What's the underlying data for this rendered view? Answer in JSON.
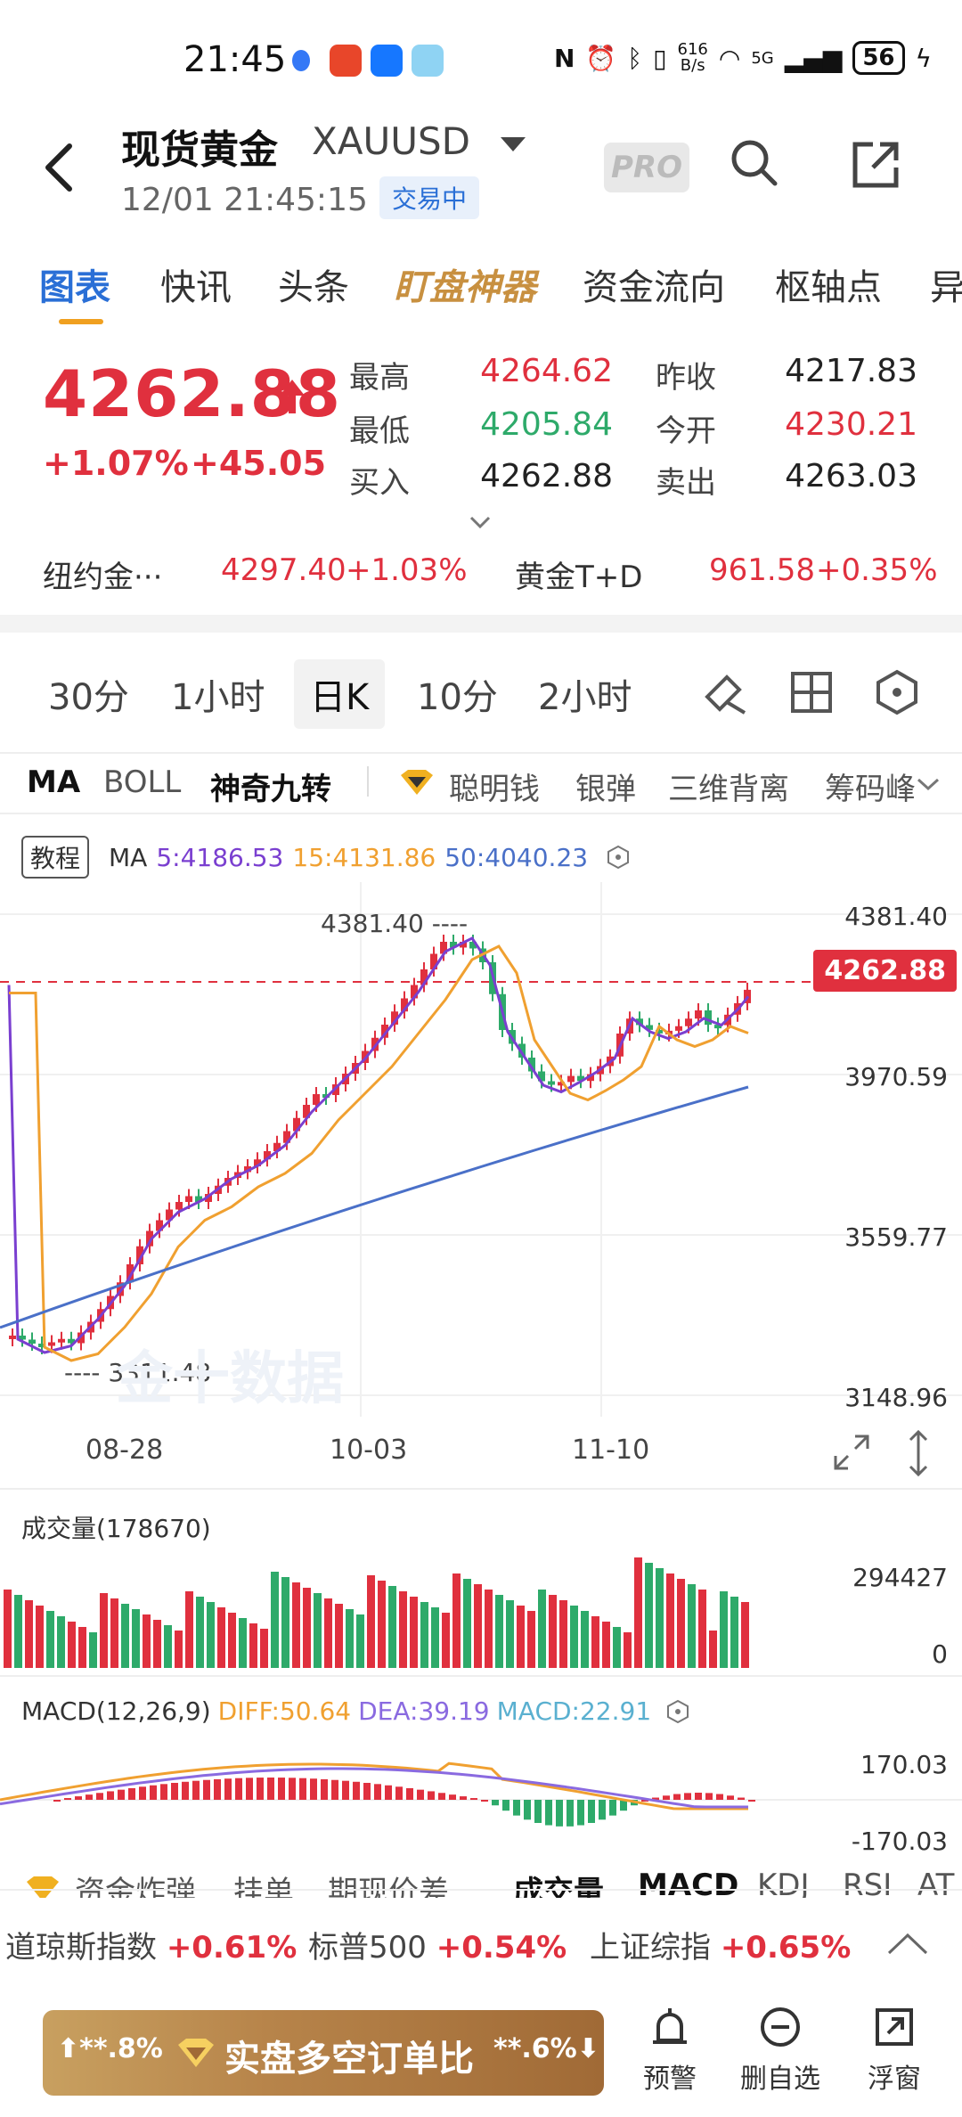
{
  "status_bar": {
    "time": "21:45",
    "net_speed_top": "616",
    "net_speed_bottom": "B/s",
    "signal": "5G",
    "battery": "56"
  },
  "header": {
    "title": "现货黄金",
    "symbol": "XAUUSD",
    "datetime": "12/01 21:45:15",
    "status_badge": "交易中",
    "pro_label": "PRO"
  },
  "tabs": [
    "图表",
    "快讯",
    "头条",
    "盯盘神器",
    "资金流向",
    "枢轴点",
    "异"
  ],
  "quote": {
    "last": "4262.88",
    "chg_pct": "+1.07%",
    "chg": "+45.05",
    "high_label": "最高",
    "high": "4264.62",
    "low_label": "最低",
    "low": "4205.84",
    "bid_label": "买入",
    "bid": "4262.88",
    "prev_label": "昨收",
    "prev": "4217.83",
    "open_label": "今开",
    "open": "4230.21",
    "ask_label": "卖出",
    "ask": "4263.03"
  },
  "related": [
    {
      "name": "纽约金···",
      "price": "4297.40",
      "chg": "+1.03%"
    },
    {
      "name": "黄金T+D",
      "price": "961.58",
      "chg": "+0.35%"
    }
  ],
  "periods": [
    "30分",
    "1小时",
    "日K",
    "10分",
    "2小时"
  ],
  "indicators": [
    "MA",
    "BOLL",
    "神奇九转",
    "聪明钱",
    "银弹",
    "三维背离",
    "筹码峰"
  ],
  "chart": {
    "tutorial": "教程",
    "ma_label": "MA",
    "ma5": "5:4186.53",
    "ma15": "15:4131.86",
    "ma50": "50:4040.23",
    "y_ticks": [
      "4381.40",
      "3970.59",
      "3559.77",
      "3148.96"
    ],
    "current_tag": "4262.88",
    "high_note": "4381.40",
    "low_note": "3311.48",
    "x_ticks": [
      "08-28",
      "10-03",
      "11-10"
    ],
    "watermark": "金十数据",
    "colors": {
      "up": "#e0303e",
      "down": "#2eaa6a",
      "ma5": "#7a3fd0",
      "ma15": "#f0a030",
      "ma50": "#4a70c8",
      "td": "#e060c0"
    }
  },
  "volume": {
    "title": "成交量(178670)",
    "max": "294427",
    "min": "0"
  },
  "macd": {
    "title": "MACD(12,26,9)",
    "diff": "DIFF:50.64",
    "dea": "DEA:39.19",
    "macd": "MACD:22.91",
    "max": "170.03",
    "min": "-170.03"
  },
  "bottom_indicators": [
    "资金炸弹",
    "挂单",
    "期现价差",
    "成交量",
    "MACD",
    "KDJ",
    "RSI",
    "AT"
  ],
  "indices": [
    {
      "name": "道琼斯指数",
      "chg": "+0.61%"
    },
    {
      "name": "标普500",
      "chg": "+0.54%"
    },
    {
      "name": "上证综指",
      "chg": "+0.65%"
    }
  ],
  "banner": {
    "left": "**.8%",
    "text": "实盘多空订单比",
    "right": "**.6%"
  },
  "bottom_buttons": [
    "预警",
    "删自选",
    "浮窗"
  ]
}
